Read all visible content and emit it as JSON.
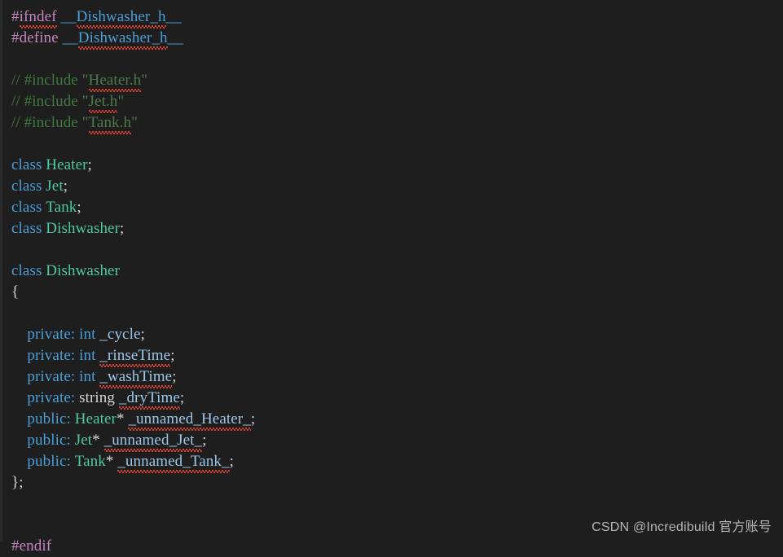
{
  "editor": {
    "language": "C++ Header",
    "background_color": "#1e1e1e",
    "gutter_color": "#2b2b2b"
  },
  "theme_colors": {
    "preprocessor": "#c586c0",
    "macro_identifier": "#4a9fd8",
    "comment": "#3f7a3f",
    "comment_string": "#4a7a4a",
    "keyword": "#4a9fd8",
    "type_name": "#4ec9a4",
    "member_name": "#9cc7e8",
    "plain_text": "#d4d4d4",
    "spellcheck_squiggle": "#d9412f",
    "watermark": "#b5b5b5"
  },
  "code": {
    "lines": [
      {
        "n": 1,
        "indent": 0,
        "tokens": [
          {
            "text": "#ifndef",
            "kind": "preprocessor",
            "squiggle_part": "ifndef"
          },
          {
            "text": " ",
            "kind": "plain"
          },
          {
            "text": "__Dishwasher_h__",
            "kind": "macro",
            "squiggle_part": "Dishwasher_h"
          }
        ]
      },
      {
        "n": 2,
        "indent": 0,
        "tokens": [
          {
            "text": "#define",
            "kind": "preprocessor"
          },
          {
            "text": " ",
            "kind": "plain"
          },
          {
            "text": "__Dishwasher_h__",
            "kind": "macro",
            "squiggle_part": "Dishwasher_h"
          }
        ]
      },
      {
        "n": 3,
        "indent": 0,
        "tokens": []
      },
      {
        "n": 4,
        "indent": 0,
        "tokens": [
          {
            "text": "// #include ",
            "kind": "comment"
          },
          {
            "text": "\"",
            "kind": "comment_string"
          },
          {
            "text": "Heater.h",
            "kind": "comment_string",
            "squiggle": true
          },
          {
            "text": "\"",
            "kind": "comment_string"
          }
        ]
      },
      {
        "n": 5,
        "indent": 0,
        "tokens": [
          {
            "text": "// #include ",
            "kind": "comment"
          },
          {
            "text": "\"",
            "kind": "comment_string"
          },
          {
            "text": "Jet.h",
            "kind": "comment_string",
            "squiggle": true
          },
          {
            "text": "\"",
            "kind": "comment_string"
          }
        ]
      },
      {
        "n": 6,
        "indent": 0,
        "tokens": [
          {
            "text": "// #include ",
            "kind": "comment"
          },
          {
            "text": "\"",
            "kind": "comment_string"
          },
          {
            "text": "Tank.h",
            "kind": "comment_string",
            "squiggle": true
          },
          {
            "text": "\"",
            "kind": "comment_string"
          }
        ]
      },
      {
        "n": 7,
        "indent": 0,
        "tokens": []
      },
      {
        "n": 8,
        "indent": 0,
        "tokens": [
          {
            "text": "class",
            "kind": "keyword"
          },
          {
            "text": " ",
            "kind": "plain"
          },
          {
            "text": "Heater",
            "kind": "type"
          },
          {
            "text": ";",
            "kind": "plain"
          }
        ]
      },
      {
        "n": 9,
        "indent": 0,
        "tokens": [
          {
            "text": "class",
            "kind": "keyword"
          },
          {
            "text": " ",
            "kind": "plain"
          },
          {
            "text": "Jet",
            "kind": "type"
          },
          {
            "text": ";",
            "kind": "plain"
          }
        ]
      },
      {
        "n": 10,
        "indent": 0,
        "tokens": [
          {
            "text": "class",
            "kind": "keyword"
          },
          {
            "text": " ",
            "kind": "plain"
          },
          {
            "text": "Tank",
            "kind": "type"
          },
          {
            "text": ";",
            "kind": "plain"
          }
        ]
      },
      {
        "n": 11,
        "indent": 0,
        "tokens": [
          {
            "text": "class",
            "kind": "keyword"
          },
          {
            "text": " ",
            "kind": "plain"
          },
          {
            "text": "Dishwasher",
            "kind": "type"
          },
          {
            "text": ";",
            "kind": "plain"
          }
        ]
      },
      {
        "n": 12,
        "indent": 0,
        "tokens": []
      },
      {
        "n": 13,
        "indent": 0,
        "tokens": [
          {
            "text": "class",
            "kind": "keyword"
          },
          {
            "text": " ",
            "kind": "plain"
          },
          {
            "text": "Dishwasher",
            "kind": "type"
          }
        ]
      },
      {
        "n": 14,
        "indent": 0,
        "tokens": [
          {
            "text": "{",
            "kind": "plain"
          }
        ]
      },
      {
        "n": 15,
        "indent": 0,
        "tokens": []
      },
      {
        "n": 16,
        "indent": 2,
        "tokens": [
          {
            "text": "private:",
            "kind": "keyword"
          },
          {
            "text": " ",
            "kind": "plain"
          },
          {
            "text": "int",
            "kind": "keyword"
          },
          {
            "text": " ",
            "kind": "plain"
          },
          {
            "text": "_cycle",
            "kind": "member"
          },
          {
            "text": ";",
            "kind": "plain"
          }
        ]
      },
      {
        "n": 17,
        "indent": 2,
        "tokens": [
          {
            "text": "private:",
            "kind": "keyword"
          },
          {
            "text": " ",
            "kind": "plain"
          },
          {
            "text": "int",
            "kind": "keyword"
          },
          {
            "text": " ",
            "kind": "plain"
          },
          {
            "text": "_rinseTime",
            "kind": "member",
            "squiggle": true
          },
          {
            "text": ";",
            "kind": "plain"
          }
        ]
      },
      {
        "n": 18,
        "indent": 2,
        "tokens": [
          {
            "text": "private:",
            "kind": "keyword"
          },
          {
            "text": " ",
            "kind": "plain"
          },
          {
            "text": "int",
            "kind": "keyword"
          },
          {
            "text": " ",
            "kind": "plain"
          },
          {
            "text": "_washTime",
            "kind": "member",
            "squiggle": true
          },
          {
            "text": ";",
            "kind": "plain"
          }
        ]
      },
      {
        "n": 19,
        "indent": 2,
        "tokens": [
          {
            "text": "private:",
            "kind": "keyword"
          },
          {
            "text": " ",
            "kind": "plain"
          },
          {
            "text": "string",
            "kind": "plain"
          },
          {
            "text": " ",
            "kind": "plain"
          },
          {
            "text": "_dryTime",
            "kind": "member",
            "squiggle": true
          },
          {
            "text": ";",
            "kind": "plain"
          }
        ]
      },
      {
        "n": 20,
        "indent": 2,
        "tokens": [
          {
            "text": "public:",
            "kind": "keyword"
          },
          {
            "text": " ",
            "kind": "plain"
          },
          {
            "text": "Heater",
            "kind": "type"
          },
          {
            "text": "* ",
            "kind": "plain"
          },
          {
            "text": "_unnamed_Heater_",
            "kind": "member",
            "squiggle": true
          },
          {
            "text": ";",
            "kind": "plain"
          }
        ]
      },
      {
        "n": 21,
        "indent": 2,
        "tokens": [
          {
            "text": "public:",
            "kind": "keyword"
          },
          {
            "text": " ",
            "kind": "plain"
          },
          {
            "text": "Jet",
            "kind": "type"
          },
          {
            "text": "* ",
            "kind": "plain"
          },
          {
            "text": "_unnamed_Jet_",
            "kind": "member",
            "squiggle": true
          },
          {
            "text": ";",
            "kind": "plain"
          }
        ]
      },
      {
        "n": 22,
        "indent": 2,
        "tokens": [
          {
            "text": "public:",
            "kind": "keyword"
          },
          {
            "text": " ",
            "kind": "plain"
          },
          {
            "text": "Tank",
            "kind": "type"
          },
          {
            "text": "* ",
            "kind": "plain"
          },
          {
            "text": "_unnamed_Tank_",
            "kind": "member",
            "squiggle": true
          },
          {
            "text": ";",
            "kind": "plain"
          }
        ]
      },
      {
        "n": 23,
        "indent": 0,
        "tokens": [
          {
            "text": "};",
            "kind": "plain"
          }
        ]
      },
      {
        "n": 24,
        "indent": 0,
        "tokens": []
      },
      {
        "n": 25,
        "indent": 0,
        "tokens": []
      },
      {
        "n": 26,
        "indent": 0,
        "tokens": [
          {
            "text": "#endif",
            "kind": "preprocessor"
          }
        ]
      }
    ]
  },
  "watermark": {
    "text": "CSDN @Incredibuild 官方账号"
  }
}
